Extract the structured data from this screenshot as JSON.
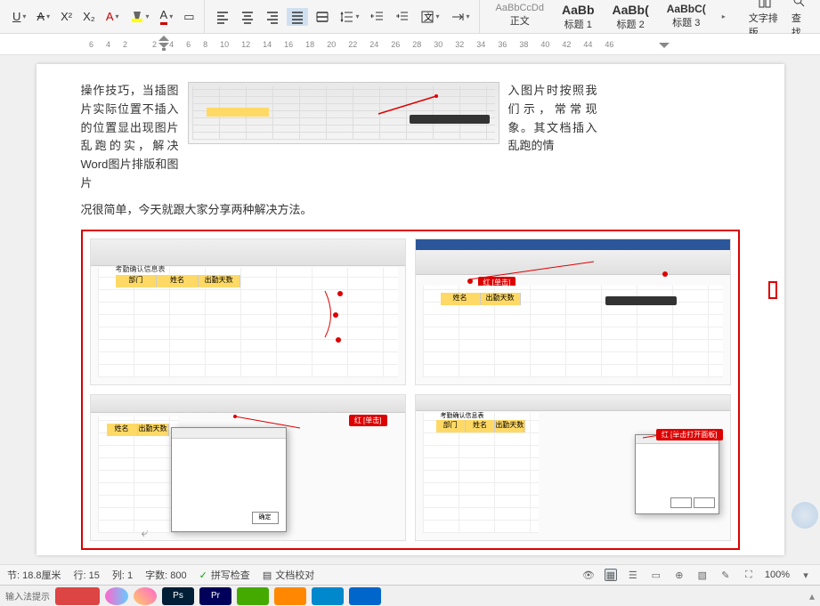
{
  "ribbon": {
    "underline": "U",
    "strike": "A",
    "superscript": "X²",
    "subscript": "X₂",
    "font_a": "A",
    "border_icon": "▭",
    "text_layout": "文字排版",
    "find": "查找"
  },
  "styles": {
    "s0": {
      "preview": "AaBbCcDd",
      "name": "正文"
    },
    "s1": {
      "preview": "AaBb",
      "name": "标题 1"
    },
    "s2": {
      "preview": "AaBb(",
      "name": "标题 2"
    },
    "s3": {
      "preview": "AaBbC(",
      "name": "标题 3"
    }
  },
  "ruler": {
    "marks": [
      "6",
      "4",
      "2",
      "",
      "2",
      "4",
      "6",
      "8",
      "10",
      "12",
      "14",
      "16",
      "18",
      "20",
      "22",
      "24",
      "26",
      "28",
      "30",
      "32",
      "34",
      "36",
      "38",
      "40",
      "42",
      "44",
      "46"
    ]
  },
  "document": {
    "left_text": "操作技巧，当插图片实际位置不插入的位置显出现图片乱跑的实，解决 Word图片排版和图片",
    "right_text": "入图片时按照我们示，常常现象。其文档插入乱跑的情",
    "final_line": "况很简单，今天就跟大家分享两种解决方法。",
    "mini_headers": {
      "h1": "部门",
      "h2": "姓名",
      "h3": "出勤天数"
    },
    "mini_label_kq": "考勤确认信息表",
    "mini_badge_1": "红 [单击]",
    "mini_badge_2": "红 [单击打开面板]"
  },
  "status": {
    "page_marker": "⤶",
    "distance": "节: 18.8厘米",
    "line": "行: 15",
    "col": "列: 1",
    "words": "字数: 800",
    "spell": "拼写检查",
    "proof": "文档校对",
    "zoom": "100%"
  },
  "taskbar": {
    "input_label": "输入法提示"
  }
}
